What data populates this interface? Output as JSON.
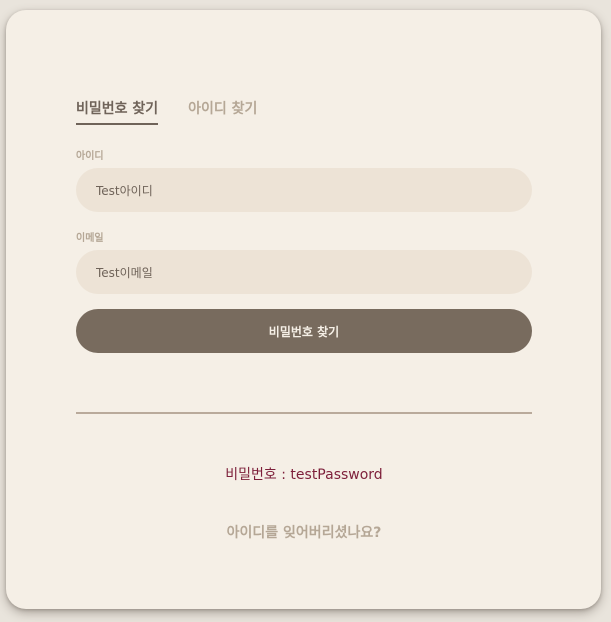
{
  "tabs": [
    {
      "label": "비밀번호 찾기",
      "active": true
    },
    {
      "label": "아이디 찾기",
      "active": false
    }
  ],
  "form": {
    "id_label": "아이디",
    "id_value": "Test아이디",
    "email_label": "이메일",
    "email_value": "Test이메일",
    "submit_label": "비밀번호 찾기"
  },
  "result": {
    "text": "비밀번호 : testPassword"
  },
  "links": {
    "forgot_id": "아이디를 잊어버리셨나요?"
  },
  "colors": {
    "card_background": "#f5efe6",
    "input_background": "#ede3d6",
    "primary_button": "#786b5e",
    "active_tab": "#6f6359",
    "muted_text": "#b5a796",
    "result_text": "#7d1f3a",
    "divider": "#b9aa9b"
  }
}
